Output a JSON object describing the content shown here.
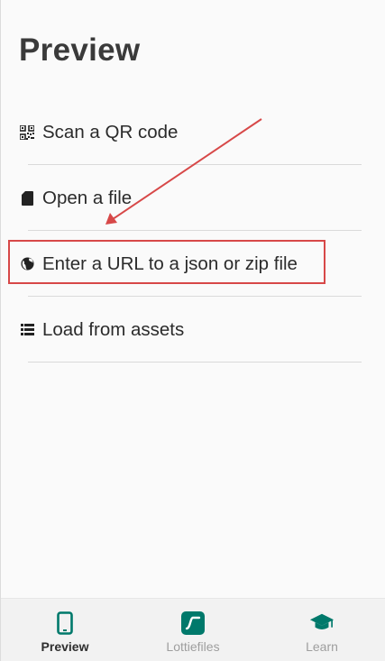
{
  "page": {
    "title": "Preview"
  },
  "menu": {
    "items": [
      {
        "label": "Scan a QR code",
        "icon": "qr-code-icon"
      },
      {
        "label": "Open a file",
        "icon": "sd-card-icon"
      },
      {
        "label": "Enter a URL to a json or zip file",
        "icon": "globe-icon"
      },
      {
        "label": "Load from assets",
        "icon": "list-icon"
      }
    ]
  },
  "annotation": {
    "color": "#d74848",
    "highlighted_item": "Enter a URL to a json or zip file"
  },
  "bottom_nav": {
    "items": [
      {
        "label": "Preview",
        "icon": "phone-icon",
        "active": true
      },
      {
        "label": "Lottiefiles",
        "icon": "lottiefiles-icon",
        "active": false
      },
      {
        "label": "Learn",
        "icon": "graduation-cap-icon",
        "active": false
      }
    ]
  },
  "colors": {
    "accent": "#00796b",
    "text": "#212121",
    "inactive": "#9e9e9e"
  }
}
